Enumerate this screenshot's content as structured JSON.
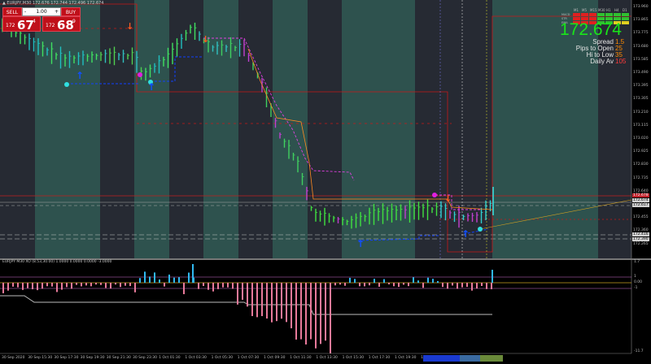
{
  "header": {
    "title": "▲ EURJPY,M30 172.676 172.744 172.496 172.674"
  },
  "trade_panel": {
    "sell_label": "SELL",
    "buy_label": "BUY",
    "lot": "1.00",
    "minus": "-",
    "plus": "+",
    "sell_small": "172",
    "sell_big": "67",
    "sell_sup": "4",
    "buy_small": "172",
    "buy_big": "68",
    "buy_sup": "9"
  },
  "price_display": {
    "price": "172.674",
    "color": "#19e619"
  },
  "info": [
    {
      "label": "Spread",
      "value": "1.5",
      "color": "#ff8a00"
    },
    {
      "label": "Pips to Open",
      "value": "25",
      "color": "#ff8a00"
    },
    {
      "label": "Hi to Low",
      "value": "35",
      "color": "#ff8a00"
    },
    {
      "label": "Daily Av",
      "value": "105",
      "color": "#ff3a3a"
    }
  ],
  "timeframes": [
    "M1",
    "M5",
    "M15",
    "M30",
    "H1",
    "H4",
    "D1"
  ],
  "tf_row_labels": [
    "MACD",
    "STR",
    "EMA"
  ],
  "price_axis": [
    "173.960",
    "173.865",
    "173.775",
    "173.680",
    "173.585",
    "173.490",
    "173.395",
    "173.305",
    "173.210",
    "173.115",
    "173.020",
    "172.925",
    "172.830",
    "172.735",
    "172.640",
    "172.545",
    "172.455",
    "172.360",
    "172.265"
  ],
  "price_tags": [
    {
      "value": "172.678",
      "color": "#c0202a"
    },
    {
      "value": "172.674",
      "color": "#d0d0d0"
    },
    {
      "value": "172.617",
      "color": "#d0d0d0"
    },
    {
      "value": "172.416",
      "color": "#d0d0d0"
    },
    {
      "value": "172.390",
      "color": "#d0d0d0"
    }
  ],
  "indicator": {
    "title": "EURJPY M30 XO (8.53,30.00) 1.0000 0.0000 0.0000 -3.0000",
    "axis": [
      "1.7",
      "1",
      "0.00",
      "-1",
      "-11.7"
    ]
  },
  "time_axis": [
    "30 Sep 2020",
    "30 Sep 15:30",
    "30 Sep 17:30",
    "30 Sep 19:30",
    "30 Sep 21:30",
    "30 Sep 23:30",
    "1 Oct 01:30",
    "1 Oct 03:30",
    "1 Oct 05:30",
    "1 Oct 07:30",
    "1 Oct 09:30",
    "1 Oct 11:30",
    "1 Oct 13:30",
    "1 Oct 15:30",
    "1 Oct 17:30",
    "1 Oct 19:30",
    "1"
  ]
}
